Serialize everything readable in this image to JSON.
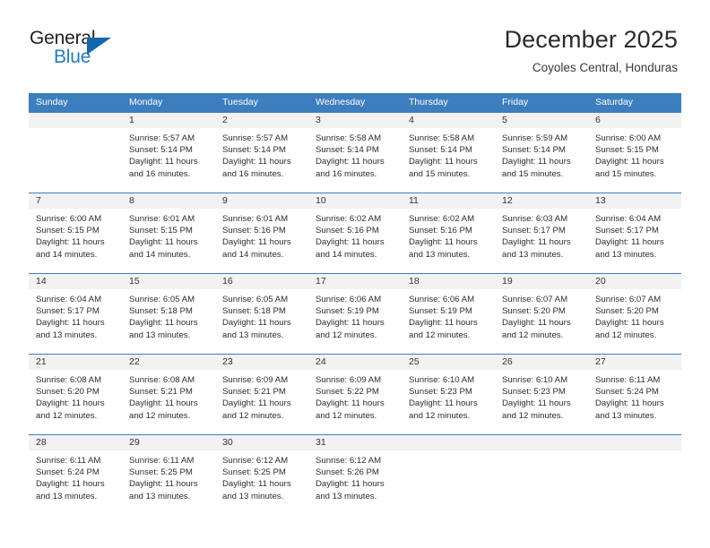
{
  "brand": {
    "name_part1": "General",
    "name_part2": "Blue",
    "logo_icon": "blue-triangle-icon"
  },
  "header": {
    "month_title": "December 2025",
    "location": "Coyoles Central, Honduras"
  },
  "colors": {
    "header_blue": "#3d7ebe",
    "brand_blue": "#1b7ec1",
    "band_gray": "#f2f2f2",
    "text": "#2d2d2d"
  },
  "labels": {
    "sunrise_prefix": "Sunrise:",
    "sunset_prefix": "Sunset:",
    "daylight_prefix": "Daylight:"
  },
  "weekday_headers": [
    "Sunday",
    "Monday",
    "Tuesday",
    "Wednesday",
    "Thursday",
    "Friday",
    "Saturday"
  ],
  "weeks": [
    [
      {
        "day": "",
        "sunrise": "",
        "sunset": "",
        "daylight_line1": "",
        "daylight_line2": ""
      },
      {
        "day": "1",
        "sunrise": "Sunrise: 5:57 AM",
        "sunset": "Sunset: 5:14 PM",
        "daylight_line1": "Daylight: 11 hours",
        "daylight_line2": "and 16 minutes."
      },
      {
        "day": "2",
        "sunrise": "Sunrise: 5:57 AM",
        "sunset": "Sunset: 5:14 PM",
        "daylight_line1": "Daylight: 11 hours",
        "daylight_line2": "and 16 minutes."
      },
      {
        "day": "3",
        "sunrise": "Sunrise: 5:58 AM",
        "sunset": "Sunset: 5:14 PM",
        "daylight_line1": "Daylight: 11 hours",
        "daylight_line2": "and 16 minutes."
      },
      {
        "day": "4",
        "sunrise": "Sunrise: 5:58 AM",
        "sunset": "Sunset: 5:14 PM",
        "daylight_line1": "Daylight: 11 hours",
        "daylight_line2": "and 15 minutes."
      },
      {
        "day": "5",
        "sunrise": "Sunrise: 5:59 AM",
        "sunset": "Sunset: 5:14 PM",
        "daylight_line1": "Daylight: 11 hours",
        "daylight_line2": "and 15 minutes."
      },
      {
        "day": "6",
        "sunrise": "Sunrise: 6:00 AM",
        "sunset": "Sunset: 5:15 PM",
        "daylight_line1": "Daylight: 11 hours",
        "daylight_line2": "and 15 minutes."
      }
    ],
    [
      {
        "day": "7",
        "sunrise": "Sunrise: 6:00 AM",
        "sunset": "Sunset: 5:15 PM",
        "daylight_line1": "Daylight: 11 hours",
        "daylight_line2": "and 14 minutes."
      },
      {
        "day": "8",
        "sunrise": "Sunrise: 6:01 AM",
        "sunset": "Sunset: 5:15 PM",
        "daylight_line1": "Daylight: 11 hours",
        "daylight_line2": "and 14 minutes."
      },
      {
        "day": "9",
        "sunrise": "Sunrise: 6:01 AM",
        "sunset": "Sunset: 5:16 PM",
        "daylight_line1": "Daylight: 11 hours",
        "daylight_line2": "and 14 minutes."
      },
      {
        "day": "10",
        "sunrise": "Sunrise: 6:02 AM",
        "sunset": "Sunset: 5:16 PM",
        "daylight_line1": "Daylight: 11 hours",
        "daylight_line2": "and 14 minutes."
      },
      {
        "day": "11",
        "sunrise": "Sunrise: 6:02 AM",
        "sunset": "Sunset: 5:16 PM",
        "daylight_line1": "Daylight: 11 hours",
        "daylight_line2": "and 13 minutes."
      },
      {
        "day": "12",
        "sunrise": "Sunrise: 6:03 AM",
        "sunset": "Sunset: 5:17 PM",
        "daylight_line1": "Daylight: 11 hours",
        "daylight_line2": "and 13 minutes."
      },
      {
        "day": "13",
        "sunrise": "Sunrise: 6:04 AM",
        "sunset": "Sunset: 5:17 PM",
        "daylight_line1": "Daylight: 11 hours",
        "daylight_line2": "and 13 minutes."
      }
    ],
    [
      {
        "day": "14",
        "sunrise": "Sunrise: 6:04 AM",
        "sunset": "Sunset: 5:17 PM",
        "daylight_line1": "Daylight: 11 hours",
        "daylight_line2": "and 13 minutes."
      },
      {
        "day": "15",
        "sunrise": "Sunrise: 6:05 AM",
        "sunset": "Sunset: 5:18 PM",
        "daylight_line1": "Daylight: 11 hours",
        "daylight_line2": "and 13 minutes."
      },
      {
        "day": "16",
        "sunrise": "Sunrise: 6:05 AM",
        "sunset": "Sunset: 5:18 PM",
        "daylight_line1": "Daylight: 11 hours",
        "daylight_line2": "and 13 minutes."
      },
      {
        "day": "17",
        "sunrise": "Sunrise: 6:06 AM",
        "sunset": "Sunset: 5:19 PM",
        "daylight_line1": "Daylight: 11 hours",
        "daylight_line2": "and 12 minutes."
      },
      {
        "day": "18",
        "sunrise": "Sunrise: 6:06 AM",
        "sunset": "Sunset: 5:19 PM",
        "daylight_line1": "Daylight: 11 hours",
        "daylight_line2": "and 12 minutes."
      },
      {
        "day": "19",
        "sunrise": "Sunrise: 6:07 AM",
        "sunset": "Sunset: 5:20 PM",
        "daylight_line1": "Daylight: 11 hours",
        "daylight_line2": "and 12 minutes."
      },
      {
        "day": "20",
        "sunrise": "Sunrise: 6:07 AM",
        "sunset": "Sunset: 5:20 PM",
        "daylight_line1": "Daylight: 11 hours",
        "daylight_line2": "and 12 minutes."
      }
    ],
    [
      {
        "day": "21",
        "sunrise": "Sunrise: 6:08 AM",
        "sunset": "Sunset: 5:20 PM",
        "daylight_line1": "Daylight: 11 hours",
        "daylight_line2": "and 12 minutes."
      },
      {
        "day": "22",
        "sunrise": "Sunrise: 6:08 AM",
        "sunset": "Sunset: 5:21 PM",
        "daylight_line1": "Daylight: 11 hours",
        "daylight_line2": "and 12 minutes."
      },
      {
        "day": "23",
        "sunrise": "Sunrise: 6:09 AM",
        "sunset": "Sunset: 5:21 PM",
        "daylight_line1": "Daylight: 11 hours",
        "daylight_line2": "and 12 minutes."
      },
      {
        "day": "24",
        "sunrise": "Sunrise: 6:09 AM",
        "sunset": "Sunset: 5:22 PM",
        "daylight_line1": "Daylight: 11 hours",
        "daylight_line2": "and 12 minutes."
      },
      {
        "day": "25",
        "sunrise": "Sunrise: 6:10 AM",
        "sunset": "Sunset: 5:23 PM",
        "daylight_line1": "Daylight: 11 hours",
        "daylight_line2": "and 12 minutes."
      },
      {
        "day": "26",
        "sunrise": "Sunrise: 6:10 AM",
        "sunset": "Sunset: 5:23 PM",
        "daylight_line1": "Daylight: 11 hours",
        "daylight_line2": "and 12 minutes."
      },
      {
        "day": "27",
        "sunrise": "Sunrise: 6:11 AM",
        "sunset": "Sunset: 5:24 PM",
        "daylight_line1": "Daylight: 11 hours",
        "daylight_line2": "and 13 minutes."
      }
    ],
    [
      {
        "day": "28",
        "sunrise": "Sunrise: 6:11 AM",
        "sunset": "Sunset: 5:24 PM",
        "daylight_line1": "Daylight: 11 hours",
        "daylight_line2": "and 13 minutes."
      },
      {
        "day": "29",
        "sunrise": "Sunrise: 6:11 AM",
        "sunset": "Sunset: 5:25 PM",
        "daylight_line1": "Daylight: 11 hours",
        "daylight_line2": "and 13 minutes."
      },
      {
        "day": "30",
        "sunrise": "Sunrise: 6:12 AM",
        "sunset": "Sunset: 5:25 PM",
        "daylight_line1": "Daylight: 11 hours",
        "daylight_line2": "and 13 minutes."
      },
      {
        "day": "31",
        "sunrise": "Sunrise: 6:12 AM",
        "sunset": "Sunset: 5:26 PM",
        "daylight_line1": "Daylight: 11 hours",
        "daylight_line2": "and 13 minutes."
      },
      {
        "day": "",
        "sunrise": "",
        "sunset": "",
        "daylight_line1": "",
        "daylight_line2": ""
      },
      {
        "day": "",
        "sunrise": "",
        "sunset": "",
        "daylight_line1": "",
        "daylight_line2": ""
      },
      {
        "day": "",
        "sunrise": "",
        "sunset": "",
        "daylight_line1": "",
        "daylight_line2": ""
      }
    ]
  ]
}
